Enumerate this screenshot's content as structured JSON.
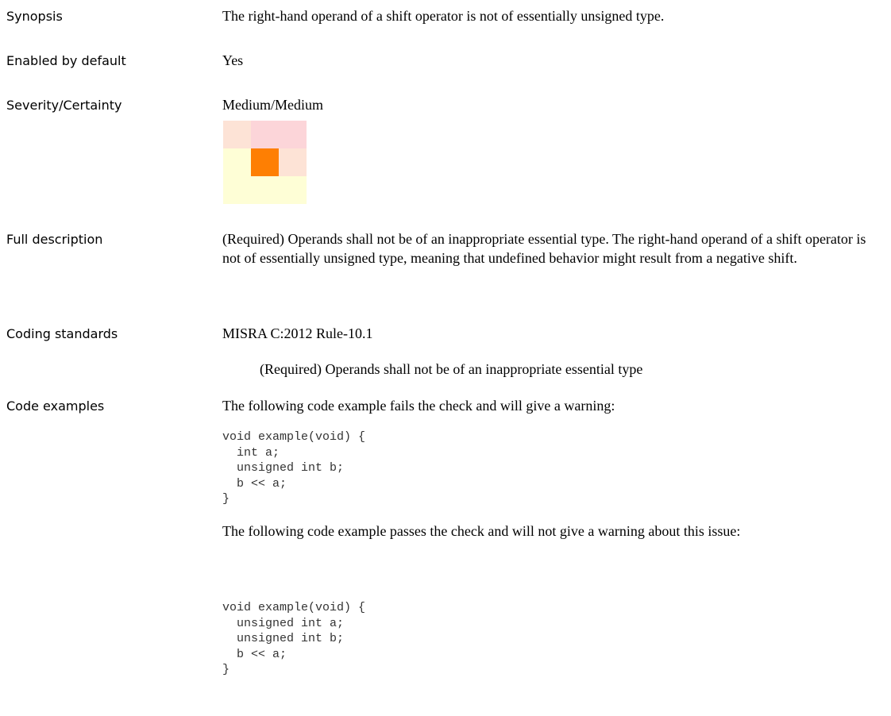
{
  "rows": {
    "synopsis": {
      "label": "Synopsis",
      "value": "The right-hand operand of a shift operator is not of essentially unsigned type."
    },
    "enabled": {
      "label": "Enabled by default",
      "value": "Yes"
    },
    "severity": {
      "label": "Severity/Certainty",
      "value": "Medium/Medium"
    },
    "full_description": {
      "label": "Full description",
      "value": "(Required) Operands shall not be of an inappropriate essential type. The right-hand operand of a shift operator is not of essentially unsigned type, meaning that undefined behavior might result from a negative shift."
    },
    "coding_standards": {
      "label": "Coding standards",
      "value": "MISRA C:2012 Rule-10.1",
      "detail": "(Required) Operands shall not be of an inappropriate essential type"
    },
    "code_examples": {
      "label": "Code examples",
      "fail_intro": "The following code example fails the check and will give a warning:",
      "fail_code": "void example(void) {\n  int a;\n  unsigned int b;\n  b << a;\n}",
      "pass_intro": "The following code example passes the check and will not give a warning about this issue:",
      "pass_code": "void example(void) {\n  unsigned int a;\n  unsigned int b;\n  b << a;\n}"
    }
  },
  "severity_grid": {
    "highlight": "Medium/Medium",
    "colors": [
      "#fde3d6",
      "#fcd5d9",
      "#fcd5d9",
      "#fefed6",
      "#fe7f03",
      "#fde3d6",
      "#fefed6",
      "#fefed6",
      "#fefed6"
    ]
  }
}
